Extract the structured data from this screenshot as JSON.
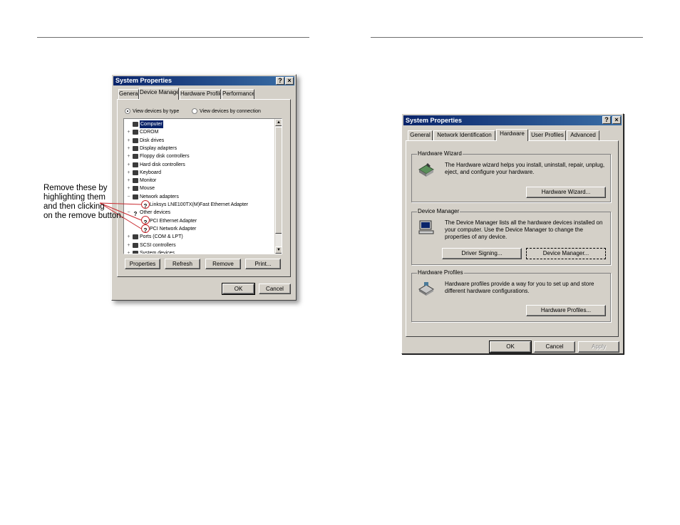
{
  "left_dialog": {
    "title": "System Properties",
    "title_buttons": [
      "?",
      "×"
    ],
    "tabs": [
      "General",
      "Device Manager",
      "Hardware Profiles",
      "Performance"
    ],
    "radio_by_type": "View devices by type",
    "radio_by_connection": "View devices by connection",
    "tree": [
      {
        "label": "Computer",
        "expander": "",
        "icon": "computer-icon",
        "selected": true
      },
      {
        "label": "CDROM",
        "expander": "+",
        "icon": "cdrom-icon"
      },
      {
        "label": "Disk drives",
        "expander": "+",
        "icon": "disk-drive-icon"
      },
      {
        "label": "Display adapters",
        "expander": "+",
        "icon": "display-adapter-icon"
      },
      {
        "label": "Floppy disk controllers",
        "expander": "+",
        "icon": "floppy-controller-icon"
      },
      {
        "label": "Hard disk controllers",
        "expander": "+",
        "icon": "hard-disk-controller-icon"
      },
      {
        "label": "Keyboard",
        "expander": "+",
        "icon": "keyboard-icon"
      },
      {
        "label": "Monitor",
        "expander": "+",
        "icon": "monitor-icon"
      },
      {
        "label": "Mouse",
        "expander": "+",
        "icon": "mouse-icon"
      },
      {
        "label": "Network adapters",
        "expander": "−",
        "icon": "network-adapter-icon"
      },
      {
        "label": "Linksys LNE100TX(M)Fast Ethernet Adapter",
        "expander": "",
        "icon": "unknown-device-icon",
        "child": true
      },
      {
        "label": "Other devices",
        "expander": "−",
        "icon": "unknown-device-icon"
      },
      {
        "label": "PCI Ethernet Adapter",
        "expander": "",
        "icon": "unknown-device-icon",
        "child": true
      },
      {
        "label": "PCI Network Adapter",
        "expander": "",
        "icon": "unknown-device-icon",
        "child": true
      },
      {
        "label": "Ports (COM & LPT)",
        "expander": "+",
        "icon": "port-icon"
      },
      {
        "label": "SCSI controllers",
        "expander": "+",
        "icon": "scsi-controller-icon"
      },
      {
        "label": "System devices",
        "expander": "+",
        "icon": "system-device-icon"
      }
    ],
    "buttons": {
      "properties": "Properties",
      "refresh": "Refresh",
      "remove": "Remove",
      "print": "Print...",
      "ok": "OK",
      "cancel": "Cancel"
    }
  },
  "callout": {
    "line1": "Remove these by",
    "line2": "highlighting them",
    "line3": "and then clicking",
    "line4": "on the remove button."
  },
  "right_dialog": {
    "title": "System Properties",
    "title_buttons": [
      "?",
      "×"
    ],
    "tabs": [
      "General",
      "Network Identification",
      "Hardware",
      "User Profiles",
      "Advanced"
    ],
    "hardware_wizard": {
      "title": "Hardware Wizard",
      "text": "The Hardware wizard helps you install, uninstall, repair, unplug, eject, and configure your hardware.",
      "button": "Hardware Wizard..."
    },
    "device_manager": {
      "title": "Device Manager",
      "text": "The Device Manager lists all the hardware devices installed on your computer. Use the Device Manager to change the properties of any device.",
      "driver_button": "Driver Signing...",
      "button": "Device Manager..."
    },
    "hardware_profiles": {
      "title": "Hardware Profiles",
      "text": "Hardware profiles provide a way for you to set up and store different hardware configurations.",
      "button": "Hardware Profiles..."
    },
    "buttons": {
      "ok": "OK",
      "cancel": "Cancel",
      "apply": "Apply"
    }
  },
  "colors": {
    "annotation_red": "#c8282e",
    "titlebar_blue": "#0a246a",
    "dialog_gray": "#d4d0c8"
  }
}
